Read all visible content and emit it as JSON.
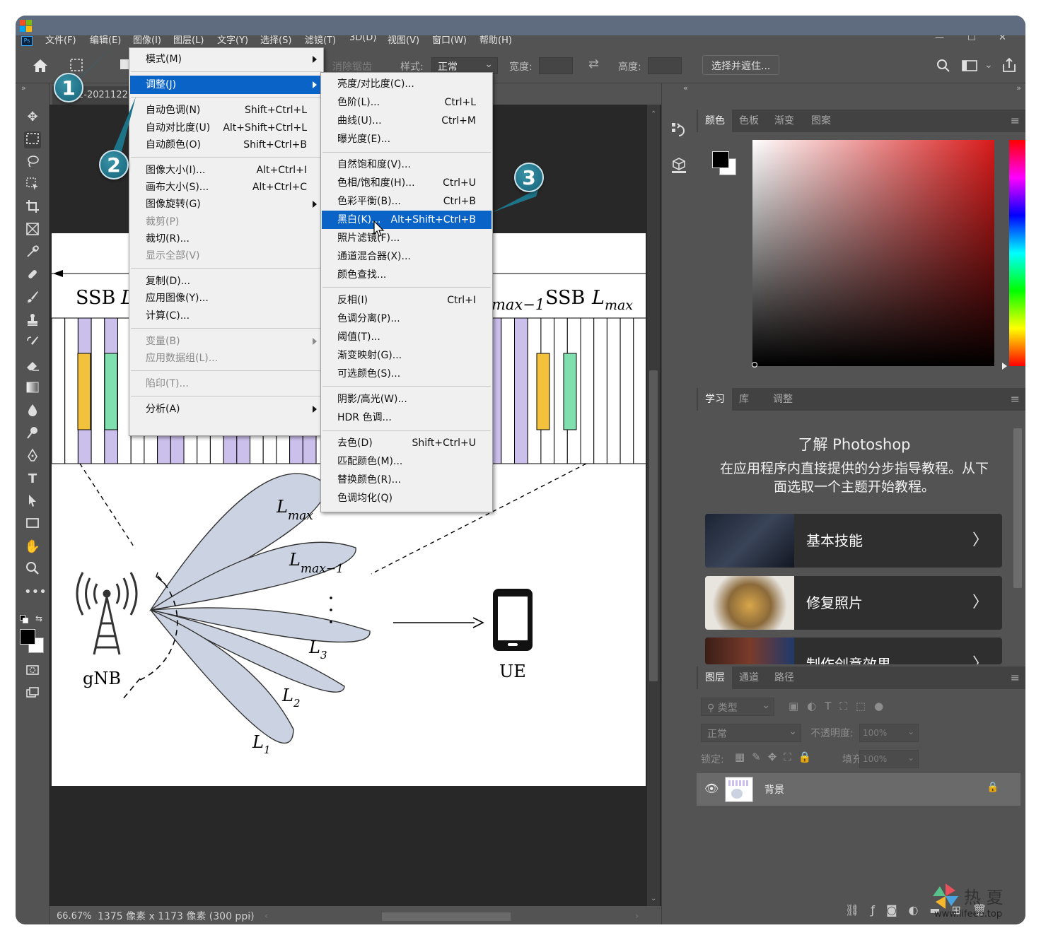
{
  "menubar": {
    "items": [
      "文件(F)",
      "编辑(E)",
      "图像(I)",
      "图层(L)",
      "文字(Y)",
      "选择(S)",
      "滤镜(T)",
      "3D(D)",
      "视图(V)",
      "窗口(W)",
      "帮助(H)"
    ],
    "ps_label": "Ps"
  },
  "options": {
    "antialias": "消除锯齿",
    "style_label": "样式:",
    "style_value": "正常",
    "width_label": "宽度:",
    "height_label": "高度:",
    "select_mask": "选择并遮住..."
  },
  "doc_tab": "2-2021122",
  "status": {
    "zoom": "66.67%",
    "info": "1375 像素 x 1173 像素 (300 ppi)"
  },
  "image_menu": [
    {
      "label": "模式(M)",
      "shortcut": "",
      "sub": true,
      "state": "normal"
    },
    {
      "sep": true
    },
    {
      "label": "调整(J)",
      "shortcut": "",
      "sub": true,
      "state": "selected"
    },
    {
      "sep": true
    },
    {
      "label": "自动色调(N)",
      "shortcut": "Shift+Ctrl+L"
    },
    {
      "label": "自动对比度(U)",
      "shortcut": "Alt+Shift+Ctrl+L"
    },
    {
      "label": "自动颜色(O)",
      "shortcut": "Shift+Ctrl+B"
    },
    {
      "sep": true
    },
    {
      "label": "图像大小(I)...",
      "shortcut": "Alt+Ctrl+I"
    },
    {
      "label": "画布大小(S)...",
      "shortcut": "Alt+Ctrl+C"
    },
    {
      "label": "图像旋转(G)",
      "shortcut": "",
      "sub": true
    },
    {
      "label": "裁剪(P)",
      "shortcut": "",
      "state": "disabled"
    },
    {
      "label": "裁切(R)...",
      "shortcut": ""
    },
    {
      "label": "显示全部(V)",
      "shortcut": "",
      "state": "disabled"
    },
    {
      "sep": true
    },
    {
      "label": "复制(D)...",
      "shortcut": ""
    },
    {
      "label": "应用图像(Y)...",
      "shortcut": ""
    },
    {
      "label": "计算(C)...",
      "shortcut": ""
    },
    {
      "sep": true
    },
    {
      "label": "变量(B)",
      "shortcut": "",
      "sub": true,
      "state": "disabled"
    },
    {
      "label": "应用数据组(L)...",
      "shortcut": "",
      "state": "disabled"
    },
    {
      "sep": true
    },
    {
      "label": "陷印(T)...",
      "shortcut": "",
      "state": "disabled"
    },
    {
      "sep": true
    },
    {
      "label": "分析(A)",
      "shortcut": "",
      "sub": true
    }
  ],
  "adjust_menu": [
    {
      "label": "亮度/对比度(C)...",
      "shortcut": ""
    },
    {
      "label": "色阶(L)...",
      "shortcut": "Ctrl+L"
    },
    {
      "label": "曲线(U)...",
      "shortcut": "Ctrl+M"
    },
    {
      "label": "曝光度(E)...",
      "shortcut": ""
    },
    {
      "sep": true
    },
    {
      "label": "自然饱和度(V)...",
      "shortcut": ""
    },
    {
      "label": "色相/饱和度(H)...",
      "shortcut": "Ctrl+U"
    },
    {
      "label": "色彩平衡(B)...",
      "shortcut": "Ctrl+B"
    },
    {
      "label": "黑白(K)...",
      "shortcut": "Alt+Shift+Ctrl+B",
      "state": "selected"
    },
    {
      "label": "照片滤镜(F)...",
      "shortcut": ""
    },
    {
      "label": "通道混合器(X)...",
      "shortcut": ""
    },
    {
      "label": "颜色查找...",
      "shortcut": ""
    },
    {
      "sep": true
    },
    {
      "label": "反相(I)",
      "shortcut": "Ctrl+I"
    },
    {
      "label": "色调分离(P)...",
      "shortcut": ""
    },
    {
      "label": "阈值(T)...",
      "shortcut": ""
    },
    {
      "label": "渐变映射(G)...",
      "shortcut": ""
    },
    {
      "label": "可选颜色(S)...",
      "shortcut": ""
    },
    {
      "sep": true
    },
    {
      "label": "阴影/高光(W)...",
      "shortcut": ""
    },
    {
      "label": "HDR 色调...",
      "shortcut": ""
    },
    {
      "sep": true
    },
    {
      "label": "去色(D)",
      "shortcut": "Shift+Ctrl+U"
    },
    {
      "label": "匹配颜色(M)...",
      "shortcut": ""
    },
    {
      "label": "替换颜色(R)...",
      "shortcut": ""
    },
    {
      "label": "色调均化(Q)",
      "shortcut": ""
    }
  ],
  "callouts": [
    "1",
    "2",
    "3"
  ],
  "color_panel": {
    "tabs": [
      "颜色",
      "色板",
      "渐变",
      "图案"
    ]
  },
  "learn_panel": {
    "tabs": [
      "学习",
      "库",
      "调整"
    ],
    "title": "了解 Photoshop",
    "desc": "在应用程序内直接提供的分步指导教程。从下面选取一个主题开始教程。",
    "cards": [
      "基本技能",
      "修复照片",
      "制作创意效果"
    ]
  },
  "layers_panel": {
    "tabs": [
      "图层",
      "通道",
      "路径"
    ],
    "filter": "类型",
    "blend": "正常",
    "opacity_label": "不透明度:",
    "opacity": "100%",
    "lock_label": "锁定:",
    "fill_label": "填充:",
    "fill": "100%",
    "layer_name": "背景"
  },
  "figure": {
    "ssb_left": "SSB",
    "ssb_right_mid": "max−1",
    "ssb_right": "SSB",
    "beams": [
      "max",
      "max−1",
      "3",
      "2",
      "1"
    ],
    "gnb": "gNB",
    "ue": "UE"
  },
  "watermark": {
    "cn": "热 夏",
    "url": "www.lifeee.top"
  },
  "colors": {
    "accent": "#0a64c8",
    "callout": "#1d7388",
    "purple": "#cbbfec",
    "yellow": "#f2c23d",
    "green": "#7fdfae",
    "beam": "#cbd3e2"
  }
}
